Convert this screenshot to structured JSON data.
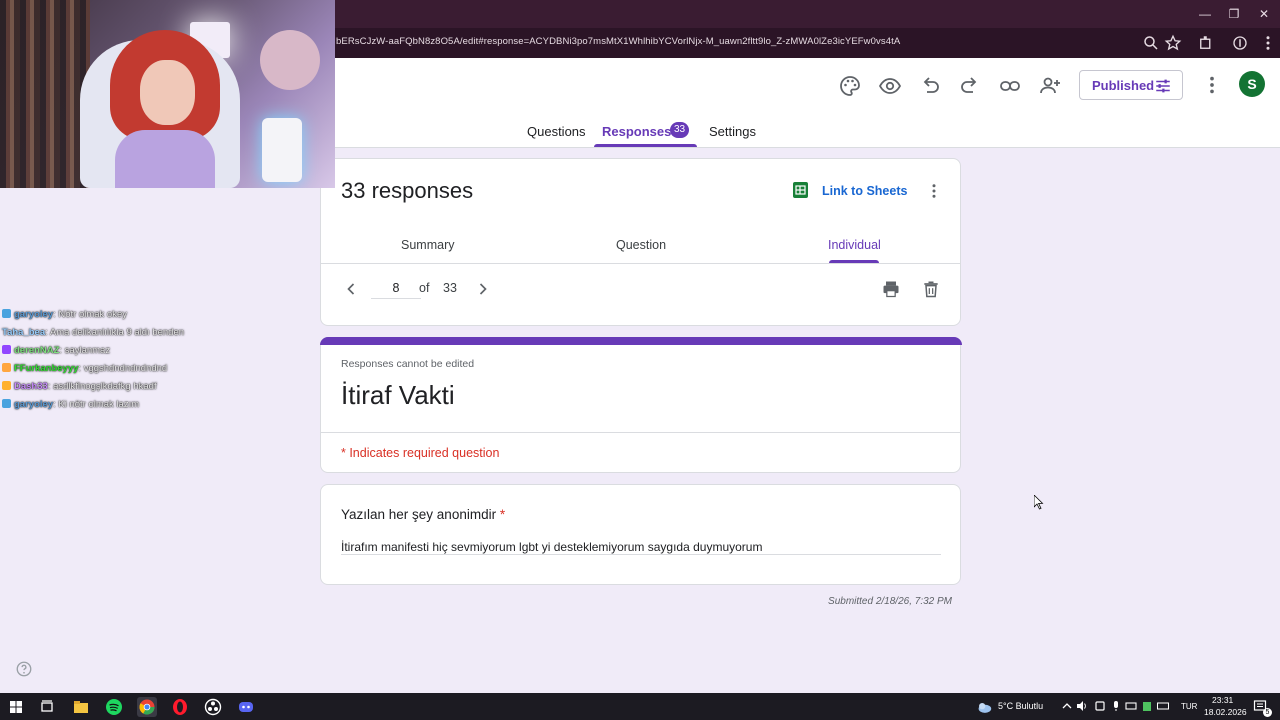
{
  "browser": {
    "url": "bERsCJzW-aaFQbN8z8O5A/edit#response=ACYDBNi3po7msMtX1WhlhibYCVorlNjx-M_uawn2fltt9lo_Z-zMWA0lZe3icYEFw0vs4tA"
  },
  "header": {
    "published_label": "Published",
    "avatar_letter": "S",
    "tabs": {
      "questions": "Questions",
      "responses": "Responses",
      "responses_count": "33",
      "settings": "Settings"
    }
  },
  "summary_card": {
    "title": "33 responses",
    "link_sheets": "Link to Sheets",
    "subtabs": {
      "summary": "Summary",
      "question": "Question",
      "individual": "Individual"
    }
  },
  "pager": {
    "current": "8",
    "of_label": "of",
    "total": "33"
  },
  "form_card": {
    "note": "Responses cannot be edited",
    "title": "İtiraf Vakti",
    "required_note": "* Indicates required question"
  },
  "question": {
    "title": "Yazılan her şey anonimdir",
    "required_star": "*",
    "answer": "İtirafım manifesti hiç sevmiyorum lgbt yi desteklemiyorum saygıda duymuyorum"
  },
  "submitted": "Submitted 2/18/26, 7:32 PM",
  "chat": [
    {
      "user": "garyoley",
      "msg": ": Nötr olmak okey",
      "color": "#5b9bd5",
      "badge": "#4aa3df"
    },
    {
      "user": "Taha_bea",
      "msg": ": Ama delikanlılıkla 9 aldı benden",
      "color": "#9ad0ff",
      "badge": ""
    },
    {
      "user": "derenNAZ",
      "msg": ": saylanmaz",
      "color": "#7fe07f",
      "badge": "#9146ff"
    },
    {
      "user": "FFurkanbeyyy",
      "msg": ": vggshdndndndndnd",
      "color": "#33dd33",
      "badge": "#ffa640"
    },
    {
      "user": "Dash33",
      "msg": ": asdlkflnogşlkdafkg hkadf",
      "color": "#c58af9",
      "badge": "#ffb02e"
    },
    {
      "user": "garyoley",
      "msg": ": Ki nötr olmak lazım",
      "color": "#5b9bd5",
      "badge": "#4aa3df"
    }
  ],
  "taskbar": {
    "weather": "5°C  Bulutlu",
    "lang": "TUR",
    "time": "23:31",
    "date": "18.02.2026",
    "notif_count": "5"
  },
  "colors": {
    "accent": "#673ab7",
    "required": "#d93025",
    "sheets": "#188038",
    "page_bg": "#f0ebf8"
  }
}
